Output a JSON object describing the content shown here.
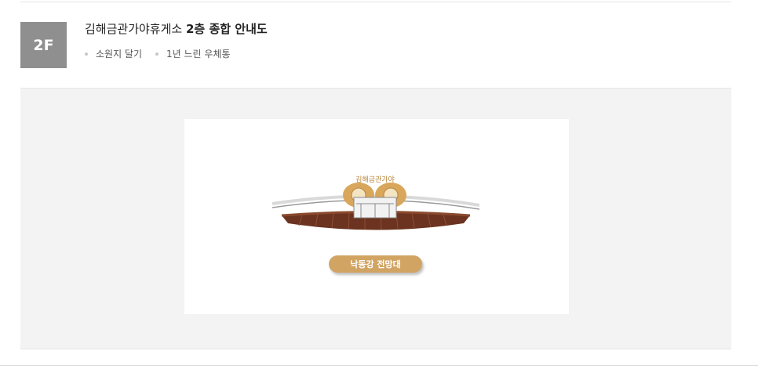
{
  "header": {
    "floor_badge": "2F",
    "title_prefix": "김해금관가야휴게소",
    "title_strong": "2층 종합 안내도",
    "tags": [
      {
        "label": "소원지 달기"
      },
      {
        "label": "1년 느린 우체통"
      }
    ]
  },
  "map": {
    "sign_text": "김해금관가야",
    "place_label": "낙동강 전망대"
  },
  "colors": {
    "badge_bg": "#8f8f8f",
    "panel_bg": "#f3f3f3",
    "accent_gold": "#d1a463",
    "deck_brown": "#6b3320"
  }
}
